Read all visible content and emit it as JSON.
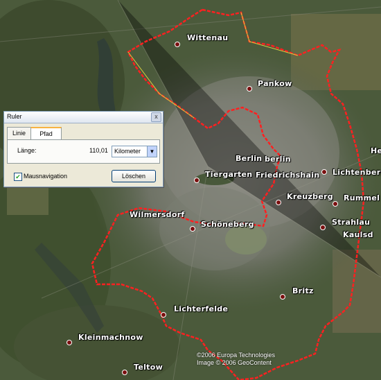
{
  "map": {
    "places": [
      {
        "name": "Wittenau"
      },
      {
        "name": "Pankow"
      },
      {
        "name": "Berlin"
      },
      {
        "name": "berlin"
      },
      {
        "name": "Tiergarten"
      },
      {
        "name": "Friedrichshain"
      },
      {
        "name": "Lichtenberg"
      },
      {
        "name": "Kreuzberg"
      },
      {
        "name": "Rummel"
      },
      {
        "name": "Wilmersdorf"
      },
      {
        "name": "Schöneberg"
      },
      {
        "name": "Strahlau"
      },
      {
        "name": "Kaulsd"
      },
      {
        "name": "Britz"
      },
      {
        "name": "Lichterfelde"
      },
      {
        "name": "Kleinmachnow"
      },
      {
        "name": "Teltow"
      },
      {
        "name": "He"
      }
    ],
    "copyright_line1": "©2006 Europa Technologies",
    "copyright_line2": "Image © 2006 GeoContent",
    "path_color": "#ff2020"
  },
  "ruler": {
    "title": "Ruler",
    "close_glyph": "x",
    "tabs": [
      "Linie",
      "Pfad"
    ],
    "active_tab": "Pfad",
    "length_label": "Länge:",
    "length_value": "110,01",
    "unit": "Kilometer",
    "mouse_nav_checked": true,
    "mouse_nav_label": "Mausnavigation",
    "clear_button": "Löschen"
  }
}
